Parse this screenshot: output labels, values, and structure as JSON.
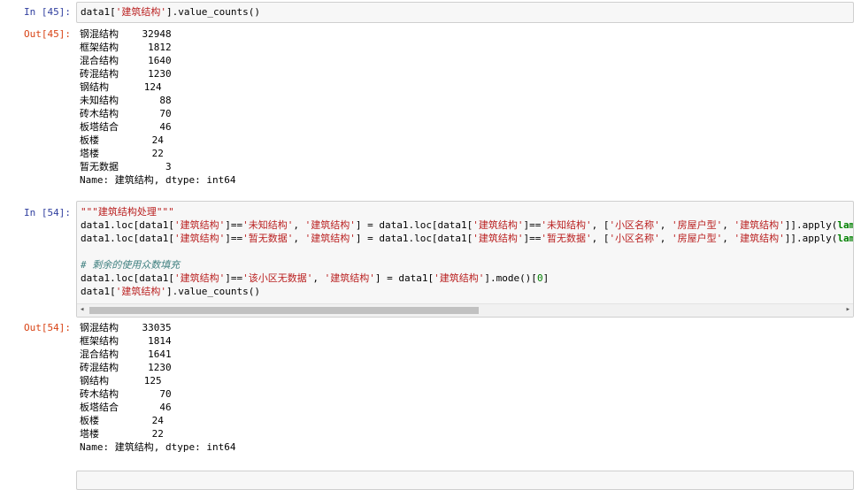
{
  "cells": {
    "c45": {
      "in_prompt": "In  [45]:",
      "code": [
        "data1['建筑结构'].value_counts()"
      ],
      "out_prompt": "Out[45]:",
      "output": [
        "钢混结构    32948",
        "框架结构     1812",
        "混合结构     1640",
        "砖混结构     1230",
        "钢结构      124",
        "未知结构       88",
        "砖木结构       70",
        "板塔结合       46",
        "板楼         24",
        "塔楼         22",
        "暂无数据        3",
        "Name: 建筑结构, dtype: int64"
      ]
    },
    "c54": {
      "in_prompt": "In  [54]:",
      "code": [
        "\"\"\"建筑结构处理\"\"\"",
        "data1.loc[data1['建筑结构']=='未知结构', '建筑结构'] = data1.loc[data1['建筑结构']=='未知结构', ['小区名称', '房屋户型', '建筑结构']].apply(lam",
        "data1.loc[data1['建筑结构']=='暂无数据', '建筑结构'] = data1.loc[data1['建筑结构']=='暂无数据', ['小区名称', '房屋户型', '建筑结构']].apply(lam",
        "",
        "# 剩余的使用众数填充",
        "data1.loc[data1['建筑结构']=='该小区无数据', '建筑结构'] = data1['建筑结构'].mode()[0]",
        "data1['建筑结构'].value_counts()"
      ],
      "out_prompt": "Out[54]:",
      "output": [
        "钢混结构    33035",
        "框架结构     1814",
        "混合结构     1641",
        "砖混结构     1230",
        "钢结构      125",
        "砖木结构       70",
        "板塔结合       46",
        "板楼         24",
        "塔楼         22",
        "Name: 建筑结构, dtype: int64"
      ]
    }
  },
  "icons": {
    "scroll_left": "scroll-left-arrow-icon",
    "scroll_right": "scroll-right-arrow-icon"
  },
  "colors": {
    "in_prompt": "#303F9F",
    "out_prompt": "#D84315",
    "string": "#BA2121",
    "comment": "#408080",
    "input_bg": "#f7f7f7"
  }
}
